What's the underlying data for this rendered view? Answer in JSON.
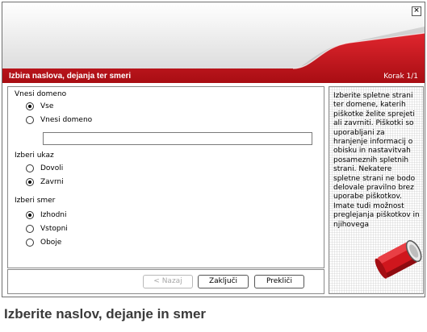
{
  "window": {
    "close_symbol": "×"
  },
  "header": {
    "title": "Izbira naslova, dejanja ter smeri",
    "step": "Korak 1/1"
  },
  "form": {
    "domain_section": {
      "label": "Vnesi domeno",
      "options": [
        "Vse",
        "Vnesi domeno"
      ],
      "selected": "Vse",
      "input_value": ""
    },
    "action_section": {
      "label": "Izberi ukaz",
      "options": [
        "Dovoli",
        "Zavrni"
      ],
      "selected": "Zavrni"
    },
    "direction_section": {
      "label": "Izberi smer",
      "options": [
        "Izhodni",
        "Vstopni",
        "Oboje"
      ],
      "selected": "Izhodni"
    }
  },
  "buttons": {
    "back": "< Nazaj",
    "finish": "Zaključi",
    "cancel": "Prekliči"
  },
  "sidebar": {
    "help_text": "Izberite spletne strani ter domene, katerih piškotke želite sprejeti ali zavrniti. Piškotki so uporabljani za hranjenje informacij o obisku in nastavitvah posameznih spletnih strani. Nekatere spletne strani ne bodo delovale pravilno brez uporabe piškotkov. Imate tudi možnost preglejanja piškotkov in njihovega"
  },
  "footer": {
    "caption": "Izberite naslov, dejanje in smer"
  },
  "colors": {
    "accent_red": "#c4141c",
    "dark_red": "#8e0b10"
  },
  "icons": {
    "cookie": "cookie-jar-icon",
    "close": "close-icon"
  }
}
